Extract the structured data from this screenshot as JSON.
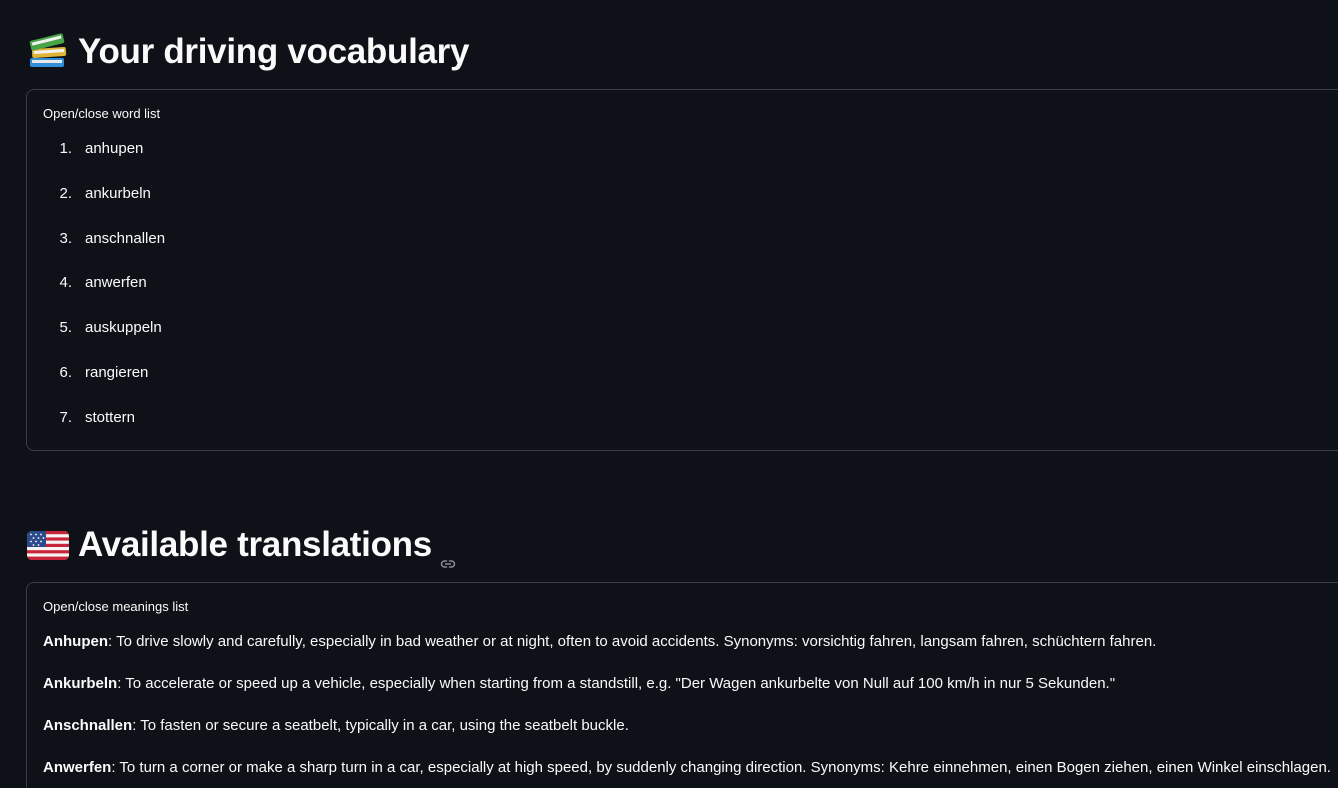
{
  "vocab_section": {
    "title": "Your driving vocabulary",
    "emoji": "books-icon",
    "expander_label": "Open/close word list",
    "words": [
      {
        "num": "1.",
        "word": "anhupen"
      },
      {
        "num": "2.",
        "word": "ankurbeln"
      },
      {
        "num": "3.",
        "word": "anschnallen"
      },
      {
        "num": "4.",
        "word": "anwerfen"
      },
      {
        "num": "5.",
        "word": "auskuppeln"
      },
      {
        "num": "6.",
        "word": "rangieren"
      },
      {
        "num": "7.",
        "word": "stottern"
      }
    ]
  },
  "translations_section": {
    "title": "Available translations",
    "emoji": "us-flag-icon",
    "expander_label": "Open/close meanings list",
    "meanings": [
      {
        "term": "Anhupen",
        "definition": ": To drive slowly and carefully, especially in bad weather or at night, often to avoid accidents. Synonyms: vorsichtig fahren, langsam fahren, schüchtern fahren."
      },
      {
        "term": "Ankurbeln",
        "definition": ": To accelerate or speed up a vehicle, especially when starting from a standstill, e.g. \"Der Wagen ankurbelte von Null auf 100 km/h in nur 5 Sekunden.\""
      },
      {
        "term": "Anschnallen",
        "definition": ": To fasten or secure a seatbelt, typically in a car, using the seatbelt buckle."
      },
      {
        "term": "Anwerfen",
        "definition": ": To turn a corner or make a sharp turn in a car, especially at high speed, by suddenly changing direction. Synonyms: Kehre einnehmen, einen Bogen ziehen, einen Winkel einschlagen."
      }
    ]
  },
  "colors": {
    "background": "#0e1117",
    "text": "#fafafa",
    "border": "#3b3d45"
  }
}
